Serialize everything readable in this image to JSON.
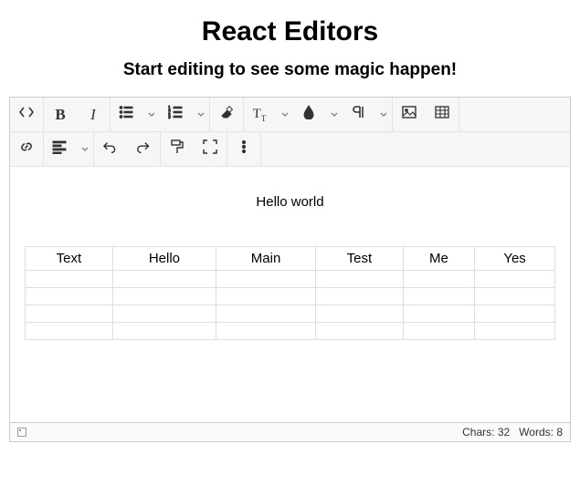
{
  "page_title": "React Editors",
  "page_subtitle": "Start editing to see some magic happen!",
  "content": {
    "paragraph": "Hello world",
    "table": {
      "headers": [
        "Text",
        "Hello",
        "Main",
        "Test",
        "Me",
        "Yes"
      ],
      "rows": [
        [
          "",
          "",
          "",
          "",
          "",
          ""
        ],
        [
          "",
          "",
          "",
          "",
          "",
          ""
        ],
        [
          "",
          "",
          "",
          "",
          "",
          ""
        ],
        [
          "",
          "",
          "",
          "",
          "",
          ""
        ]
      ]
    }
  },
  "status": {
    "chars_label": "Chars:",
    "chars": "32",
    "words_label": "Words:",
    "words": "8"
  },
  "toolbar": {
    "row1": [
      {
        "group": [
          {
            "id": "code-view",
            "icon": "code"
          }
        ]
      },
      {
        "group": [
          {
            "id": "bold",
            "icon": "bold"
          },
          {
            "id": "italic",
            "icon": "italic"
          }
        ]
      },
      {
        "group": [
          {
            "id": "unordered-list",
            "icon": "ul",
            "dd": true
          },
          {
            "id": "ordered-list",
            "icon": "ol",
            "dd": true
          }
        ]
      },
      {
        "group": [
          {
            "id": "eraser",
            "icon": "eraser"
          }
        ]
      },
      {
        "group": [
          {
            "id": "paragraph-format",
            "icon": "tt",
            "dd": true
          },
          {
            "id": "text-color",
            "icon": "drop",
            "dd": true
          },
          {
            "id": "paragraph-style",
            "icon": "pilcrow",
            "dd": true
          }
        ]
      },
      {
        "group": [
          {
            "id": "insert-image",
            "icon": "image"
          },
          {
            "id": "insert-table",
            "icon": "table"
          }
        ]
      }
    ],
    "row2": [
      {
        "group": [
          {
            "id": "insert-link",
            "icon": "link"
          }
        ]
      },
      {
        "group": [
          {
            "id": "align",
            "icon": "align",
            "dd": true
          }
        ]
      },
      {
        "group": [
          {
            "id": "undo",
            "icon": "undo"
          },
          {
            "id": "redo",
            "icon": "redo"
          }
        ]
      },
      {
        "group": [
          {
            "id": "format-painter",
            "icon": "paint"
          },
          {
            "id": "fullscreen",
            "icon": "fullscreen"
          }
        ]
      },
      {
        "group": [
          {
            "id": "more",
            "icon": "more"
          }
        ]
      }
    ]
  }
}
